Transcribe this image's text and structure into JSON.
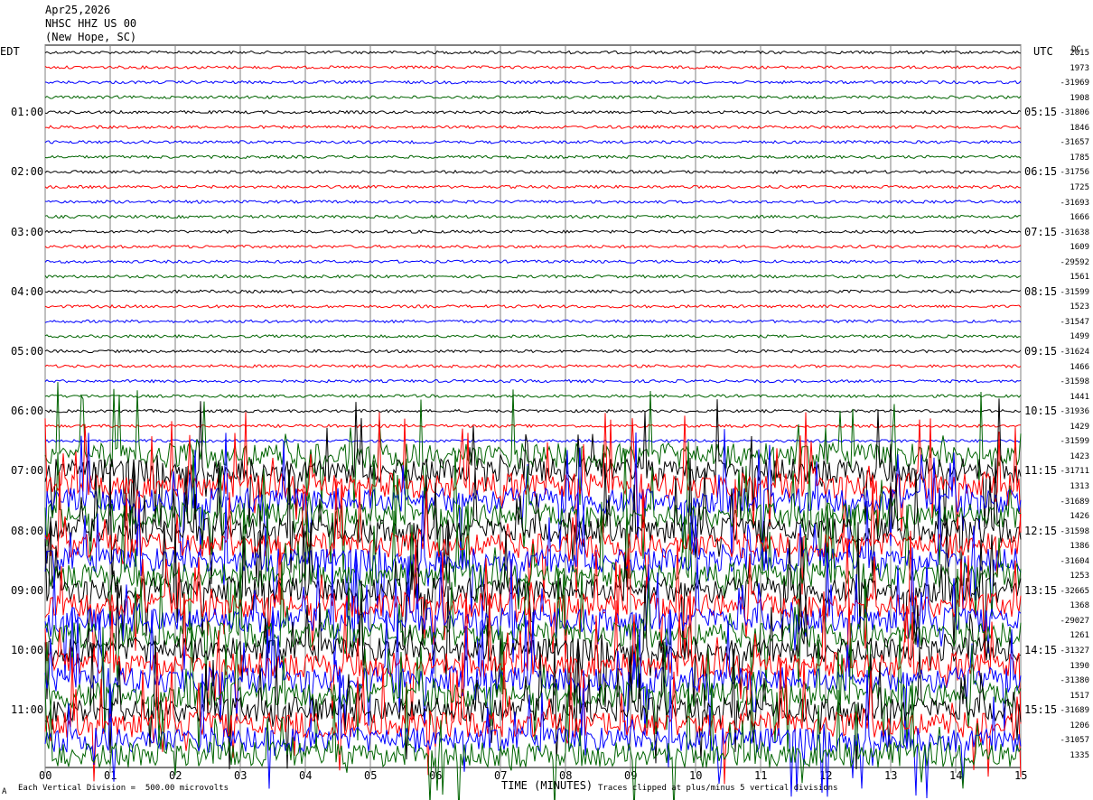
{
  "header": {
    "date": "Apr25,2026",
    "station": "NHSC HHZ US 00",
    "location": "(New Hope, SC)"
  },
  "left_tz": "EDT",
  "right_tz": "UTC",
  "dc_label": "DC",
  "footer": {
    "scale_note": "Each Vertical Division =  500.00 microvolts",
    "clip_note": "Traces clipped at plus/minus 5 vertical divisions",
    "corner_mark": "A"
  },
  "colors": {
    "black": "#000000",
    "red": "#ff0000",
    "blue": "#0000ff",
    "green": "#006400",
    "grid": "#000000"
  },
  "chart_data": {
    "type": "line",
    "chart_kind": "helicorder seismogram",
    "xlabel": "TIME (MINUTES)",
    "x_ticks": [
      "00",
      "01",
      "02",
      "03",
      "04",
      "05",
      "06",
      "07",
      "08",
      "09",
      "10",
      "11",
      "12",
      "13",
      "14",
      "15"
    ],
    "xlim": [
      0,
      15
    ],
    "line_minutes": 15,
    "left_hour_labels": [
      "01:00",
      "02:00",
      "03:00",
      "04:00",
      "05:00",
      "06:00",
      "07:00",
      "08:00",
      "09:00",
      "10:00",
      "11:00"
    ],
    "right_hour_labels": [
      "05:15",
      "06:15",
      "07:15",
      "08:15",
      "09:15",
      "10:15",
      "11:15",
      "12:15",
      "13:15",
      "14:15",
      "15:15"
    ],
    "trace_color_cycle": [
      "black",
      "red",
      "blue",
      "green"
    ],
    "dc_offsets": [
      "2015",
      "1973",
      "-31969",
      "1908",
      "-31806",
      "1846",
      "-31657",
      "1785",
      "-31756",
      "1725",
      "-31693",
      "1666",
      "-31638",
      "1609",
      "-29592",
      "1561",
      "-31599",
      "1523",
      "-31547",
      "1499",
      "-31624",
      "1466",
      "-31598",
      "1441",
      "-31936",
      "1429",
      "-31599",
      "1423",
      "-31711",
      "1313",
      "-31689",
      "1426",
      "-31598",
      "1386",
      "-31604",
      "1253",
      "-32665",
      "1368",
      "-29027",
      "1261",
      "-31327",
      "1390",
      "-31380",
      "1517",
      "-31689",
      "1206",
      "-31057",
      "1335"
    ],
    "amplitude_regime": [
      {
        "from_line": 0,
        "to_line": 26,
        "level": "quiet"
      },
      {
        "from_line": 27,
        "to_line": 47,
        "level": "high, many traces clipped"
      }
    ],
    "clip_divisions": 5
  }
}
